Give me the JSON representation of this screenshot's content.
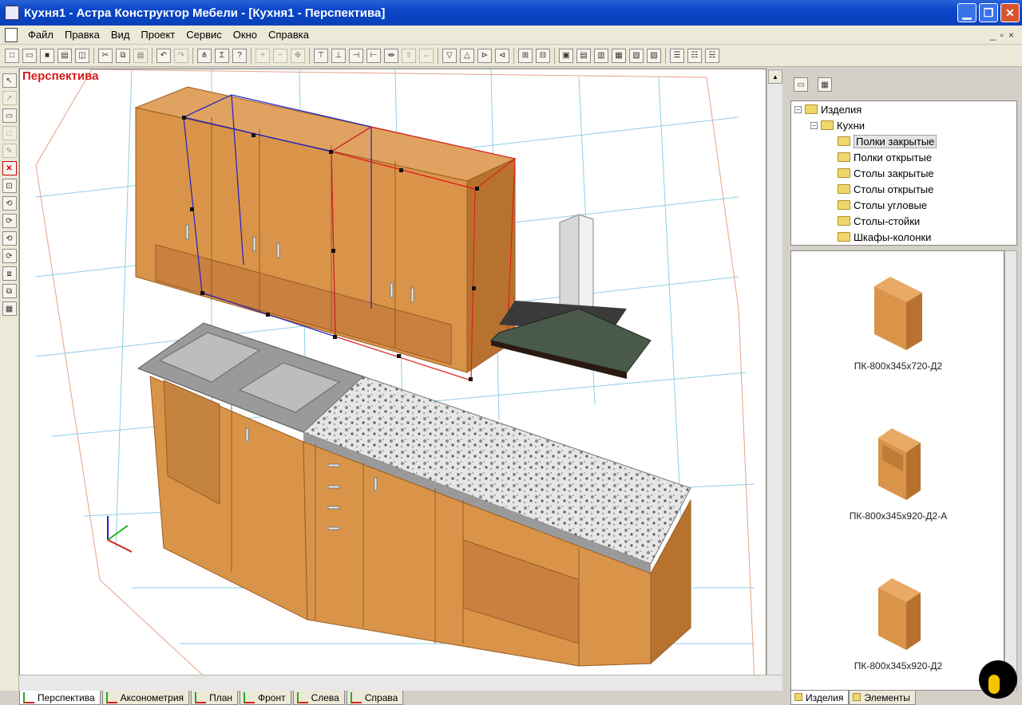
{
  "window": {
    "title": "Кухня1 - Астра Конструктор Мебели - [Кухня1 - Перспектива]",
    "minimize_glyph": "▁",
    "restore_glyph": "❐",
    "close_glyph": "✕"
  },
  "menu": {
    "items": [
      "Файл",
      "Правка",
      "Вид",
      "Проект",
      "Сервис",
      "Окно",
      "Справка"
    ],
    "mdi_min": "_",
    "mdi_restore": "▫",
    "mdi_close": "×"
  },
  "viewport": {
    "label": "Перспектива"
  },
  "tabs": [
    {
      "label": "Перспектива",
      "active": true
    },
    {
      "label": "Аксонометрия",
      "active": false
    },
    {
      "label": "План",
      "active": false
    },
    {
      "label": "Фронт",
      "active": false
    },
    {
      "label": "Слева",
      "active": false
    },
    {
      "label": "Справа",
      "active": false
    }
  ],
  "tree": {
    "root": "Изделия",
    "group": "Кухни",
    "items": [
      {
        "label": "Полки закрытые",
        "selected": true
      },
      {
        "label": "Полки открытые",
        "selected": false
      },
      {
        "label": "Столы закрытые",
        "selected": false
      },
      {
        "label": "Столы открытые",
        "selected": false
      },
      {
        "label": "Столы угловые",
        "selected": false
      },
      {
        "label": "Столы-стойки",
        "selected": false
      },
      {
        "label": "Шкафы-колонки",
        "selected": false
      }
    ]
  },
  "thumbnails": [
    {
      "label": "ПК-800x345x720-Д2"
    },
    {
      "label": "ПК-800x345x920-Д2-А"
    },
    {
      "label": "ПК-800x345x920-Д2"
    }
  ],
  "right_tabs": [
    {
      "label": "Изделия",
      "active": true
    },
    {
      "label": "Элементы",
      "active": false
    }
  ],
  "colors": {
    "wood": "#d9944a",
    "wood_dark": "#b8722f",
    "selection_blue": "#2020c0",
    "selection_red": "#e02020",
    "grid": "#8ecfe6",
    "label_red": "#d81818"
  },
  "icons": {
    "toolbar": [
      "new-icon",
      "open-icon",
      "save-icon",
      "print-icon",
      "preview-icon",
      "cut-icon",
      "copy-icon",
      "paste-icon",
      "undo-icon",
      "redo-icon",
      "tree-icon",
      "sum-icon",
      "help-icon",
      "zoom-in-icon",
      "zoom-out-icon",
      "pan-icon"
    ]
  }
}
